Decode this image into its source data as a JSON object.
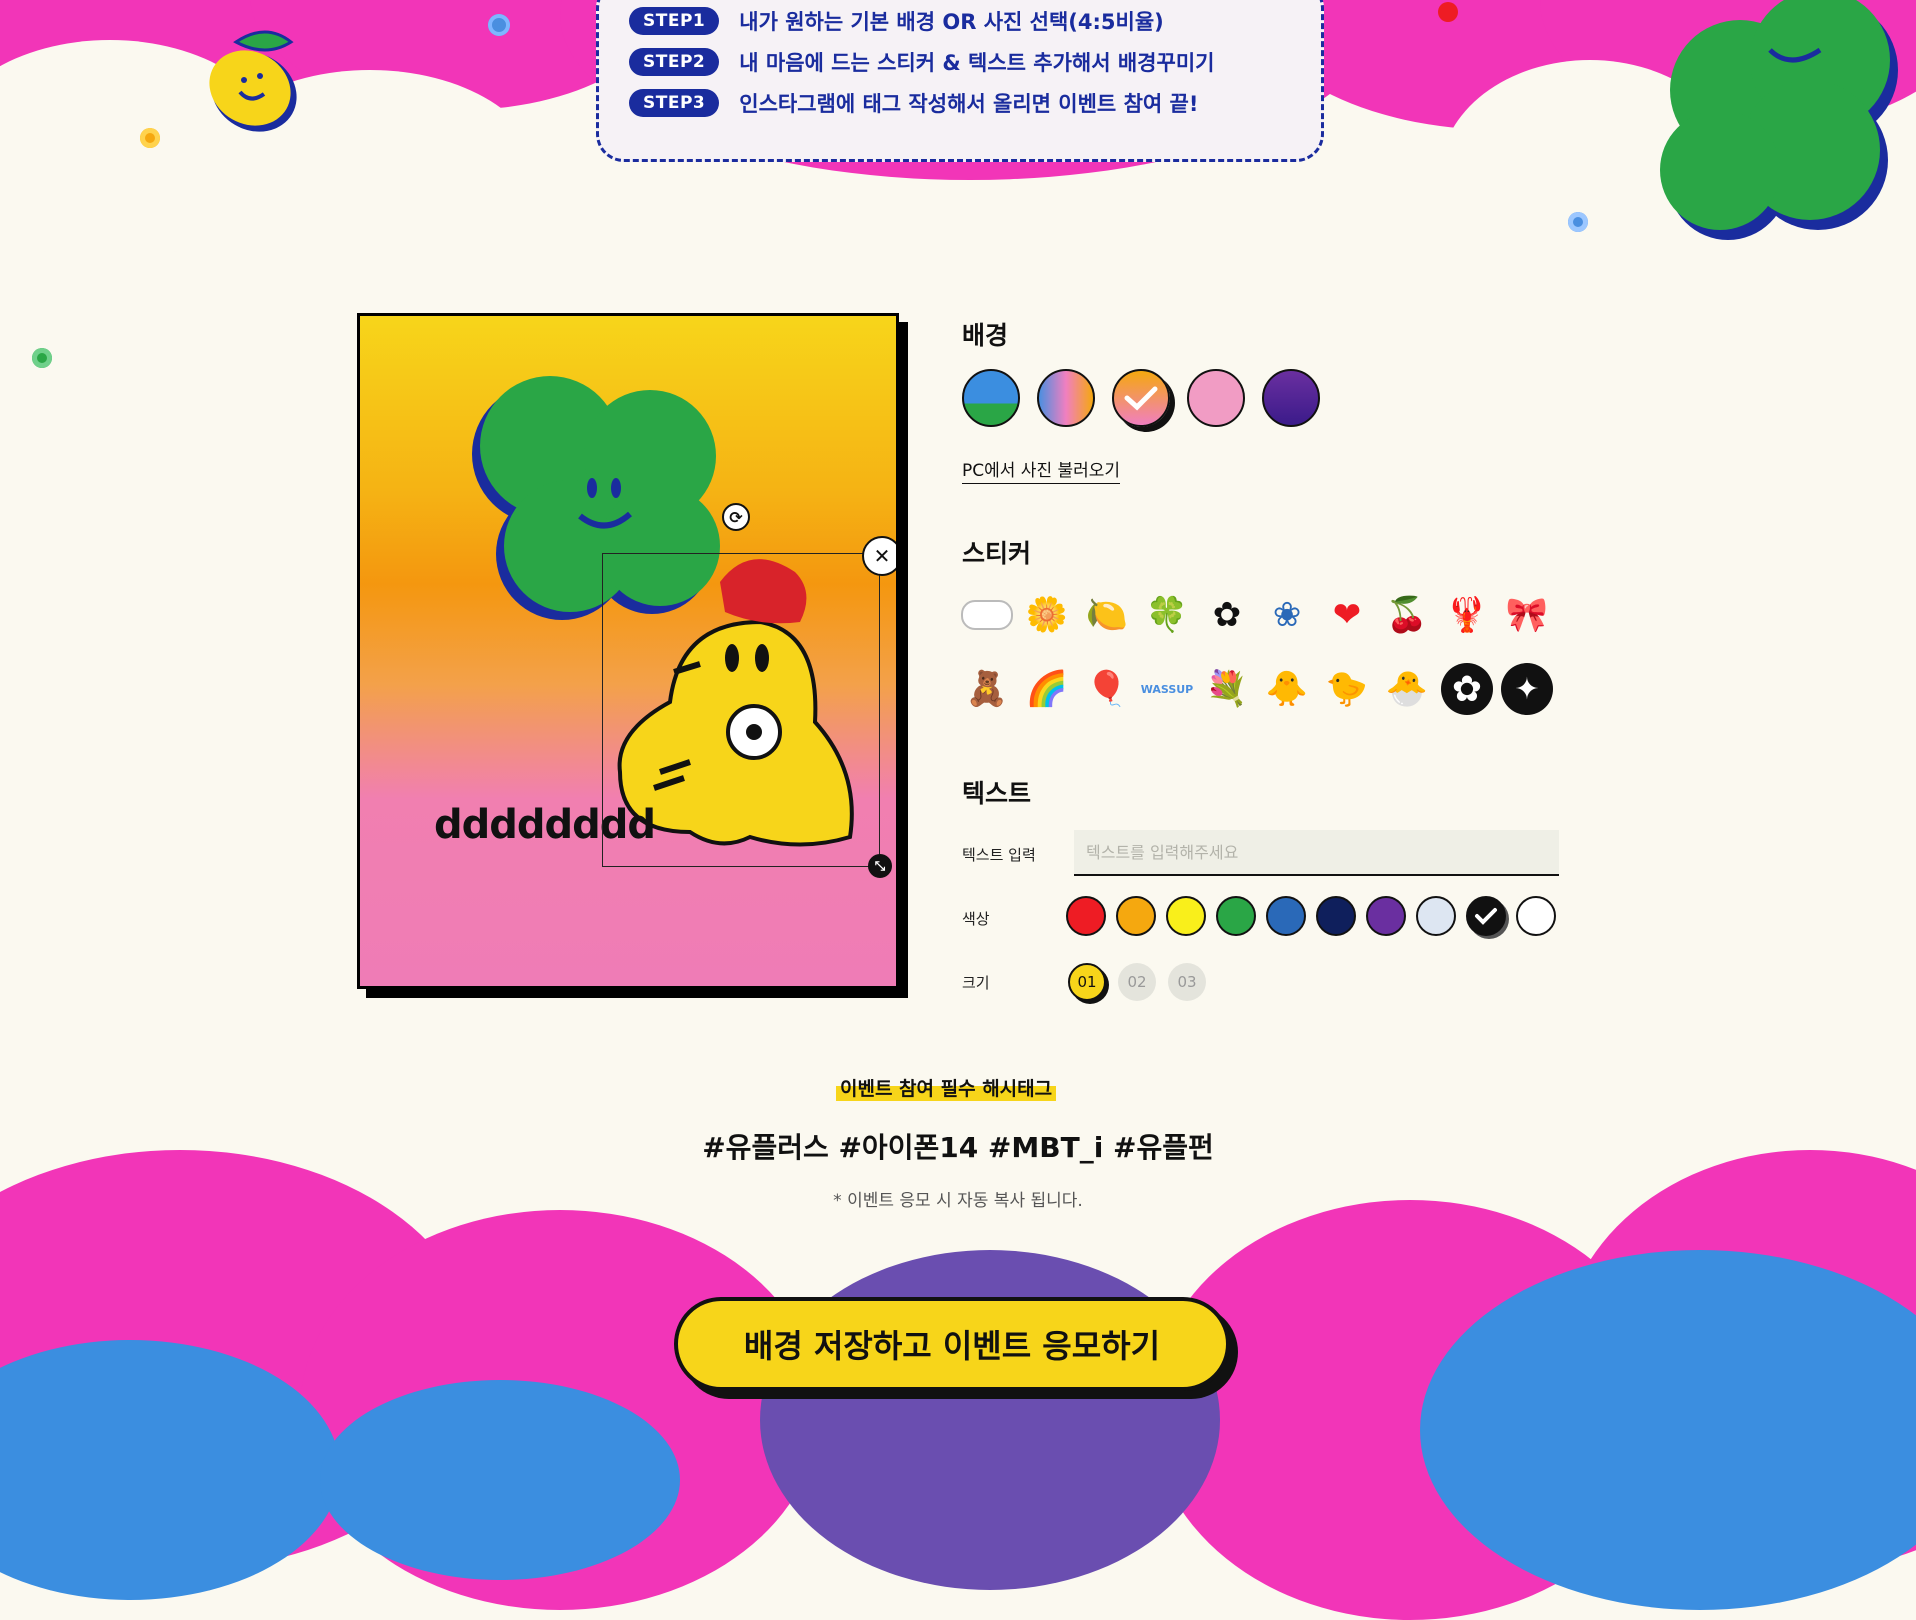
{
  "steps": [
    {
      "badge": "STEP1",
      "text": "내가 원하는 기본 배경 OR 사진 선택(4:5비율)"
    },
    {
      "badge": "STEP2",
      "text": "내 마음에 드는 스티커 & 텍스트 추가해서 배경꾸미기"
    },
    {
      "badge": "STEP3",
      "text": "인스타그램에 태그 작성해서 올리면 이벤트 참여 끝!"
    }
  ],
  "preview": {
    "overlay_text": "dddddddd"
  },
  "background": {
    "title": "배경",
    "swatches": [
      {
        "name": "blue-green",
        "selected": false
      },
      {
        "name": "blue-pink-gradient",
        "selected": false
      },
      {
        "name": "yellow-pink-gradient",
        "selected": true
      },
      {
        "name": "pink",
        "selected": false
      },
      {
        "name": "purple",
        "selected": false
      }
    ],
    "pc_upload_label": "PC에서 사진 불러오기"
  },
  "sticker": {
    "title": "스티커",
    "items": [
      "cloud-icon",
      "daisy-icon",
      "lemon-icon",
      "clover-icon",
      "white-flower-icon",
      "blue-flower-icon",
      "heart-icon",
      "cherry-icon",
      "lobster-icon",
      "ribbon-icon",
      "bear-icon",
      "rainbow-icon",
      "balloons-icon",
      "wassup-text-icon",
      "bouquet-icon",
      "chick-red-hat-icon",
      "chick-icon",
      "chick-small-icon",
      "black-daisy-icon",
      "sparkle-icon"
    ]
  },
  "text_section": {
    "title": "텍스트",
    "input_label": "텍스트 입력",
    "input_placeholder": "텍스트를 입력해주세요",
    "input_value": "",
    "color_label": "색상",
    "colors": [
      "#ee1c24",
      "#f5a80f",
      "#f9ef1b",
      "#2aa646",
      "#2a69b8",
      "#0f1f5c",
      "#6a2fa0",
      "#dde6f2",
      "#111111",
      "#ffffff"
    ],
    "selected_color": "#111111",
    "size_label": "크기",
    "sizes": [
      "01",
      "02",
      "03"
    ],
    "selected_size": "01"
  },
  "hashtag": {
    "label": "이벤트 참여 필수 해시태그",
    "tags": "#유플러스 #아이폰14 #MBT_i #유플펀",
    "note": "* 이벤트 응모 시 자동 복사 됩니다."
  },
  "submit": {
    "label": "배경 저장하고 이벤트 응모하기"
  },
  "colors": {
    "brand_pink": "#f235b8",
    "brand_navy": "#1a2c9e",
    "brand_yellow": "#f7d51a",
    "cream": "#fbf9f0"
  }
}
